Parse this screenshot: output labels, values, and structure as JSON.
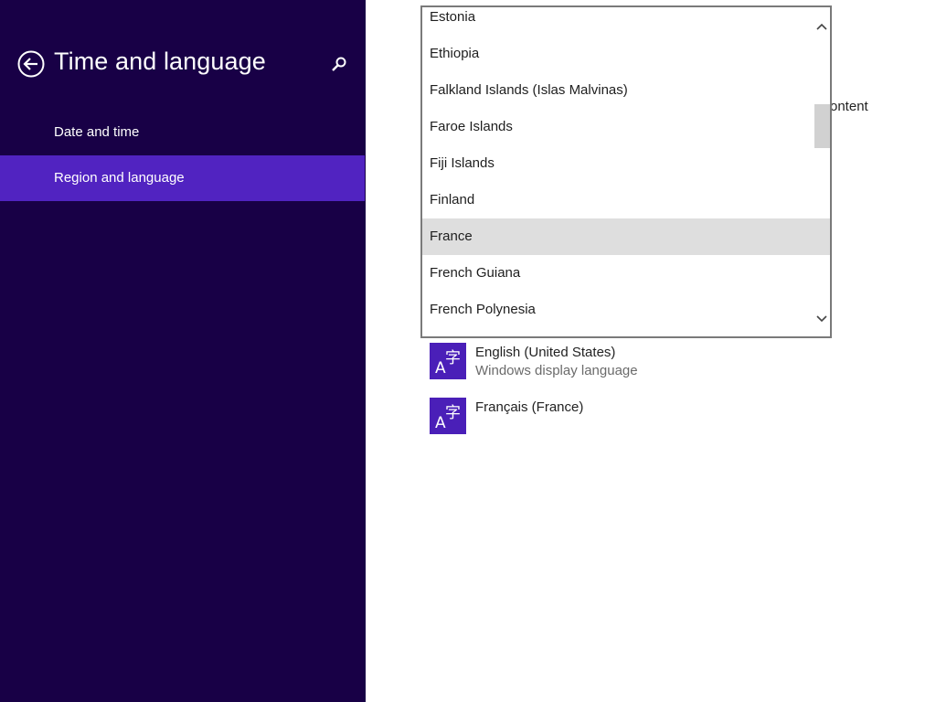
{
  "sidebar": {
    "title": "Time and language",
    "back_icon": "back-arrow-icon",
    "search_icon": "search-icon",
    "items": [
      {
        "label": "Date and time",
        "selected": false
      },
      {
        "label": "Region and language",
        "selected": true
      }
    ]
  },
  "main": {
    "partial_label": "ontent",
    "country_dropdown": {
      "options": [
        "Estonia",
        "Ethiopia",
        "Falkland Islands (Islas Malvinas)",
        "Faroe Islands",
        "Fiji Islands",
        "Finland",
        "France",
        "French Guiana",
        "French Polynesia"
      ],
      "selected": "France",
      "scroll_up_icon": "chevron-up-icon",
      "scroll_down_icon": "chevron-down-icon"
    },
    "languages": [
      {
        "name": "English (United States)",
        "subtitle": "Windows display language",
        "icon": "language-icon"
      },
      {
        "name": "Français (France)",
        "subtitle": "",
        "icon": "language-icon"
      }
    ]
  },
  "colors": {
    "sidebar_bg": "#180046",
    "sidebar_selected": "#5123c1",
    "tile_bg": "#4a1fb8",
    "list_selected": "#dedede"
  }
}
